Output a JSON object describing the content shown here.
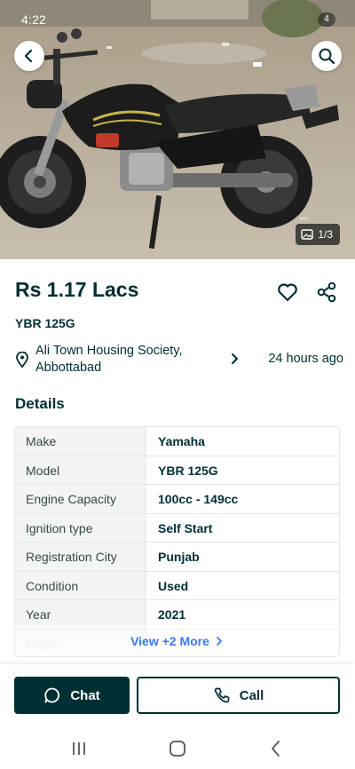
{
  "status_bar": {
    "time": "4:22",
    "notification_count": "4"
  },
  "gallery": {
    "counter": "1/3"
  },
  "listing": {
    "price": "Rs 1.17 Lacs",
    "title": "YBR 125G",
    "location": "Ali Town Housing Society, Abbottabad",
    "posted": "24 hours ago"
  },
  "details": {
    "heading": "Details",
    "rows": [
      {
        "key": "Make",
        "value": "Yamaha"
      },
      {
        "key": "Model",
        "value": "YBR 125G"
      },
      {
        "key": "Engine Capacity",
        "value": "100cc - 149cc"
      },
      {
        "key": "Ignition type",
        "value": "Self Start"
      },
      {
        "key": "Registration City",
        "value": "Punjab"
      },
      {
        "key": "Condition",
        "value": "Used"
      },
      {
        "key": "Year",
        "value": "2021"
      },
      {
        "key": "Origin",
        "value": ""
      }
    ],
    "view_more": "View +2 More"
  },
  "actions": {
    "chat": "Chat",
    "call": "Call"
  },
  "colors": {
    "primary": "#002f34",
    "link": "#3a77ff",
    "table_key_bg": "#f2f4f5",
    "border": "#e2e6e7"
  },
  "icons": [
    "back-arrow-icon",
    "search-icon",
    "gallery-icon",
    "heart-icon",
    "share-icon",
    "location-pin-icon",
    "chevron-right-icon",
    "chat-bubble-icon",
    "phone-icon",
    "recents-icon",
    "home-icon",
    "back-nav-icon"
  ]
}
